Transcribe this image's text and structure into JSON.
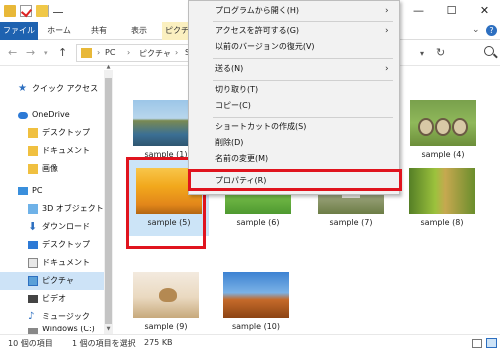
{
  "ribbon": {
    "tabs": [
      "ファイル",
      "ホーム",
      "共有",
      "表示",
      "ピクチ"
    ]
  },
  "address": {
    "crumbs": [
      "PC",
      "ピクチャ",
      "Sa"
    ]
  },
  "sidebar": {
    "items": [
      {
        "label": "クイック アクセス",
        "icon": "star-icon"
      },
      {
        "label": "OneDrive",
        "icon": "cloud-icon"
      },
      {
        "label": "デスクトップ",
        "icon": "folder-icon"
      },
      {
        "label": "ドキュメント",
        "icon": "folder-icon"
      },
      {
        "label": "画像",
        "icon": "folder-icon"
      },
      {
        "label": "PC",
        "icon": "pc-icon"
      },
      {
        "label": "3D オブジェクト",
        "icon": "cube-icon"
      },
      {
        "label": "ダウンロード",
        "icon": "download-icon"
      },
      {
        "label": "デスクトップ",
        "icon": "desktop-icon"
      },
      {
        "label": "ドキュメント",
        "icon": "document-icon"
      },
      {
        "label": "ピクチャ",
        "icon": "pictures-icon"
      },
      {
        "label": "ビデオ",
        "icon": "video-icon"
      },
      {
        "label": "ミュージック",
        "icon": "music-icon"
      },
      {
        "label": "Windows (C:)",
        "icon": "drive-icon"
      }
    ]
  },
  "files": [
    {
      "name": "sample (1)"
    },
    {
      "name": "sample (4)"
    },
    {
      "name": "sample (5)"
    },
    {
      "name": "sample (6)"
    },
    {
      "name": "sample (7)"
    },
    {
      "name": "sample (8)"
    },
    {
      "name": "sample (9)"
    },
    {
      "name": "sample (10)"
    }
  ],
  "context_menu": {
    "items": [
      "プログラムから開く(H)",
      "アクセスを許可する(G)",
      "以前のバージョンの復元(V)",
      "送る(N)",
      "切り取り(T)",
      "コピー(C)",
      "ショートカットの作成(S)",
      "削除(D)",
      "名前の変更(M)",
      "プロパティ(R)"
    ],
    "submenu_arrow": "›"
  },
  "status": {
    "count": "10 個の項目",
    "selected": "1 個の項目を選択",
    "size": "275 KB"
  },
  "window": {
    "minimize": "—",
    "maximize": "☐",
    "close": "✕"
  },
  "colors": {
    "accent": "#1e62b0",
    "highlight": "#e0141e",
    "selection": "#cce4f7"
  }
}
